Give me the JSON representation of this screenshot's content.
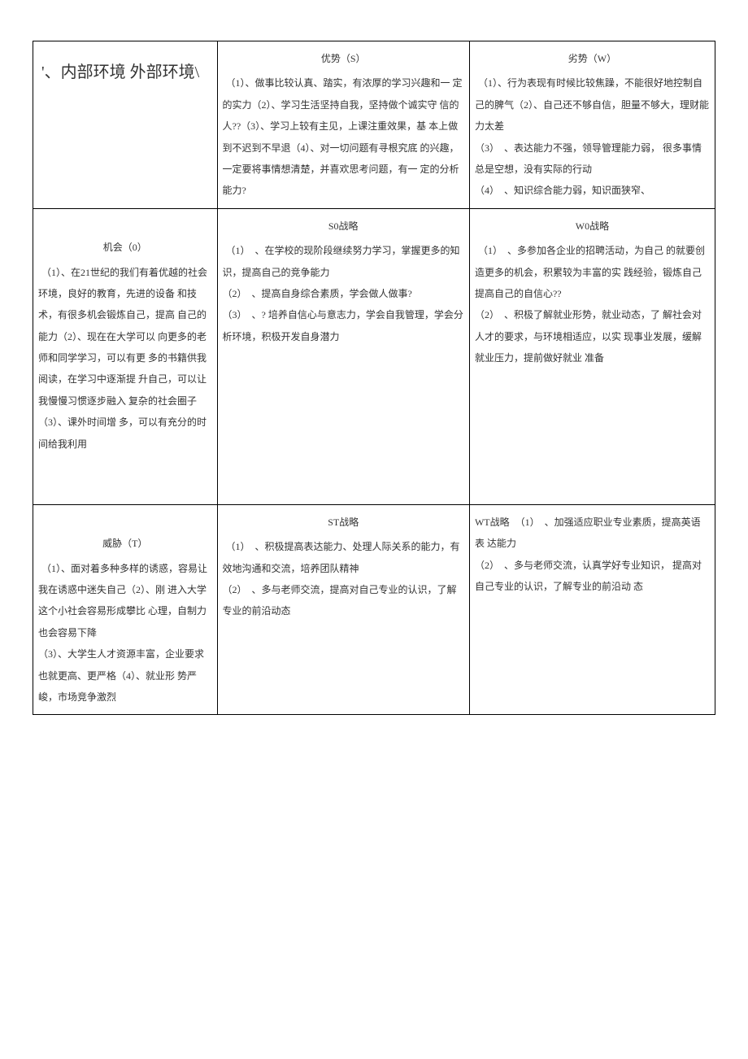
{
  "table": {
    "r1": {
      "c1": "'、内部环境 外部环境\\",
      "c2_title": "优势（S）",
      "c2_body": "（1）、做事比较认真、踏实，有浓厚的学习兴趣和一 定的实力（2）、学习生活坚持自我，坚持做个诚实守 信的人??（3）、学习上较有主见，上课注重效果，基 本上做到不迟到不早退（4）、对一切问题有寻根究底 的兴趣，一定要将事情想清楚，并喜欢思考问题，有一 定的分析能力?",
      "c3_title": "劣势（W）",
      "c3_body": "（1）、行为表现有时候比较焦躁，不能很好地控制自己的脾气（2）、自己还不够自信，胆量不够大，理财能力太差\n（3）　、表达能力不强，领导管理能力弱， 很多事情总是空想，没有实际的行动\n（4）　、知识综合能力弱，知识面狭窄、"
    },
    "r2": {
      "c1_title": "机会（0）",
      "c1_body": "（1）、在21世纪的我们有着优越的社会环境，良好的教育，先进的设备 和技术，有很多机会锻炼自己，提高 自己的能力（2）、现在在大学可以 向更多的老师和同学学习，可以有更 多的书籍供我阅读，在学习中逐渐提 升自己，可以让我慢慢习惯逐步融入 复杂的社会圈子（3）、课外时间增 多，可以有充分的时间给我利用",
      "c2_title": "S0战略",
      "c2_body": "（1）　、在学校的现阶段继续努力学习，掌握更多的知 识，提高自己的竞争能力\n（2）　、提高自身综合素质，学会做人做事?\n（3）　、? 培养自信心与意志力，学会自我管理，学会分\n析环境，积极开发自身潜力",
      "c3_title": "W0战略",
      "c3_body": "（1）　、多参加各企业的招聘活动，为自己 的就要创造更多的机会，积累较为丰富的实 践经验，锻炼自己提高自己的自信心??\n（2）　、积极了解就业形势，就业动态，了 解社会对人才的要求，与环境相适应，以实 现事业发展，缓解就业压力，提前做好就业 准备"
    },
    "r3": {
      "c1_title": "威胁（T）",
      "c1_body": "（1）、面对着多种多样的诱惑，容易让我在诱惑中迷失自己（2）、刚 进入大学这个小社会容易形成攀比 心理，自制力也会容易下降\n（3）、大学生人才资源丰富，企业要求也就更高、更严格（4）、就业形 势严峻，市场竞争激烈",
      "c2_title": "ST战略",
      "c2_body": "（1）　、积极提高表达能力、处理人际关系的能力，有 效地沟通和交流，培养团队精神\n（2）　、多与老师交流，提高对自己专业的认识，了解 专业的前沿动态",
      "c3_title": "WT战略",
      "c3_body": "（1）　、加强适应职业专业素质，提高英语表 达能力\n（2）　、多与老师交流，认真学好专业知识， 提高对自己专业的认识，了解专业的前沿动 态"
    }
  }
}
